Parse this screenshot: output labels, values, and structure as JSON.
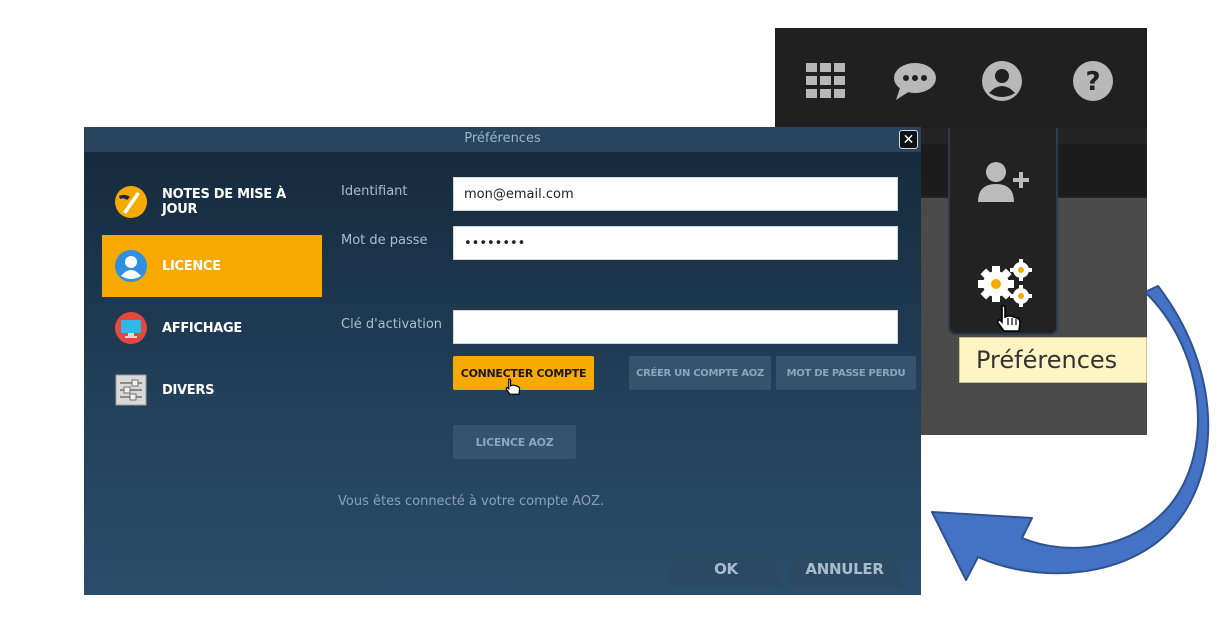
{
  "background_app": {
    "top_icons": [
      "apps-grid-icon",
      "chat-icon",
      "user-icon",
      "help-icon"
    ],
    "menu_icons": [
      "add-user-icon",
      "gears-icon"
    ],
    "tooltip": "Préférences"
  },
  "dialog": {
    "title": "Préférences",
    "close_icon": "close-icon",
    "nav": [
      {
        "label": "NOTES DE MISE À JOUR",
        "icon": "release-notes-icon",
        "active": false
      },
      {
        "label": "LICENCE",
        "icon": "licence-user-icon",
        "active": true
      },
      {
        "label": "AFFICHAGE",
        "icon": "display-monitor-icon",
        "active": false
      },
      {
        "label": "DIVERS",
        "icon": "settings-sliders-icon",
        "active": false
      }
    ],
    "form": {
      "identifier_label": "Identifiant",
      "identifier_value": "mon@email.com",
      "password_label": "Mot de passe",
      "password_value": "••••••••",
      "activation_label": "Clé d'activation",
      "activation_value": ""
    },
    "buttons": {
      "connect": "CONNECTER COMPTE",
      "create": "CRÉER UN COMPTE AOZ",
      "lost_password": "MOT DE PASSE PERDU",
      "licence": "LICENCE AOZ"
    },
    "status": "Vous êtes connecté à votre compte AOZ.",
    "footer": {
      "ok": "OK",
      "cancel": "ANNULER"
    }
  },
  "colors": {
    "accent": "#f6aa00",
    "dialog_bg": "#213f58",
    "arrow": "#4472c4"
  }
}
